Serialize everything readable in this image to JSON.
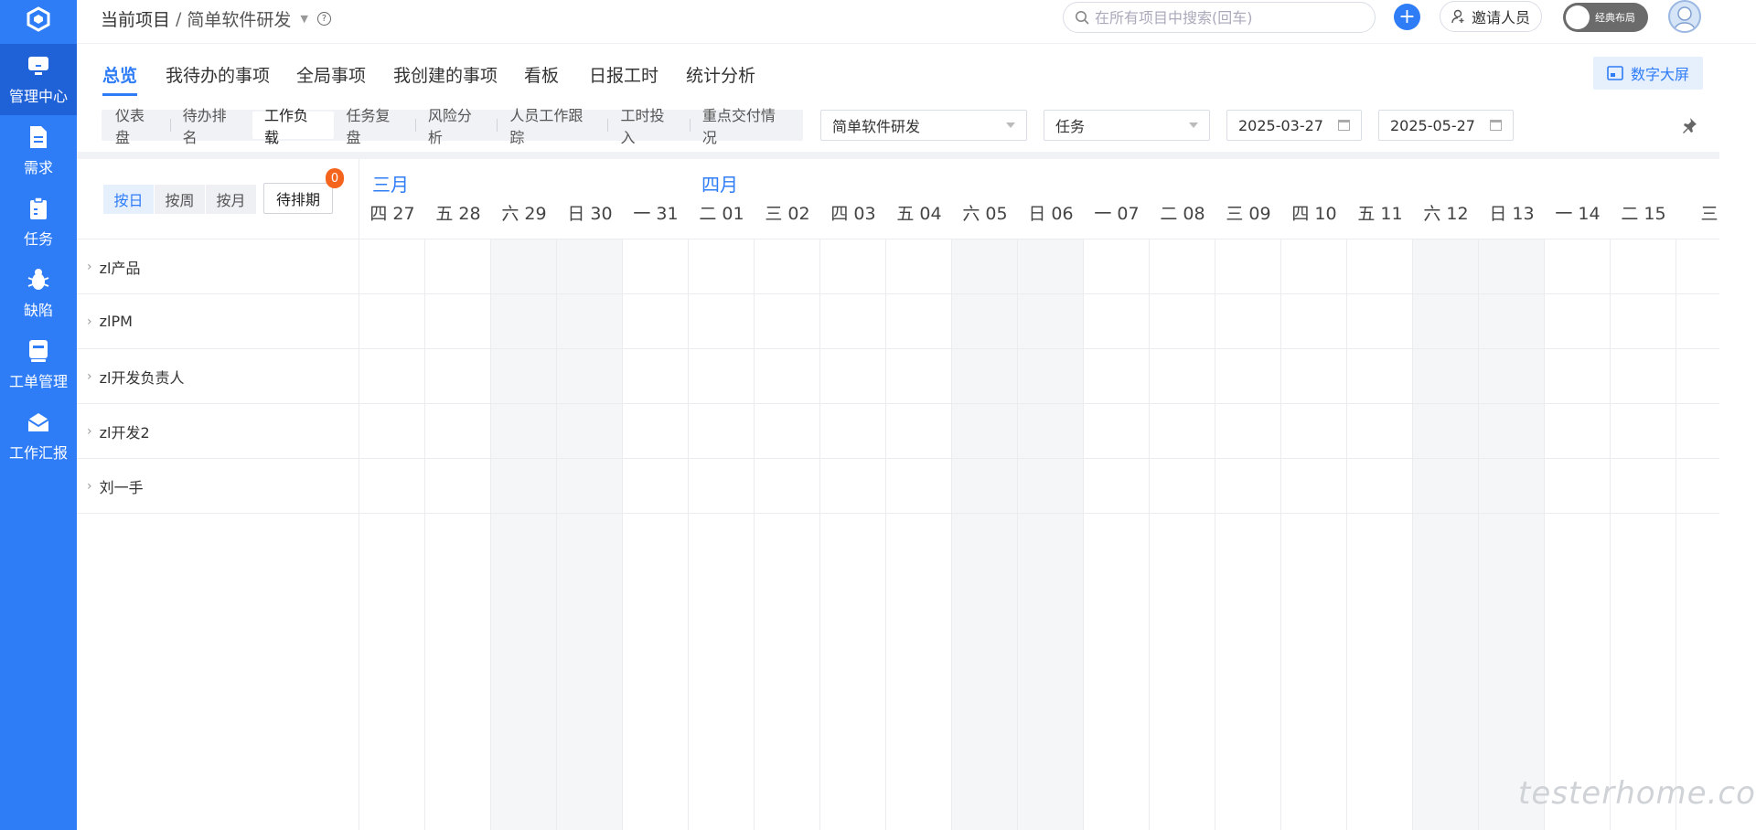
{
  "sidebar": {
    "items": [
      {
        "label": "管理中心",
        "icon": "monitor-icon"
      },
      {
        "label": "需求",
        "icon": "document-icon"
      },
      {
        "label": "任务",
        "icon": "clipboard-icon"
      },
      {
        "label": "缺陷",
        "icon": "bug-icon"
      },
      {
        "label": "工单管理",
        "icon": "ticket-icon"
      },
      {
        "label": "工作汇报",
        "icon": "envelope-icon"
      }
    ]
  },
  "header": {
    "breadcrumb_root": "当前项目",
    "breadcrumb_sep": "/",
    "project": "简单软件研发",
    "help": "?",
    "search_placeholder": "在所有项目中搜索(回车)",
    "add": "+",
    "invite": "邀请人员",
    "toggle_label": "经典布局"
  },
  "tabs": [
    "总览",
    "我待办的事项",
    "全局事项",
    "我创建的事项",
    "看板",
    "日报工时",
    "统计分析"
  ],
  "big_screen": "数字大屏",
  "subtabs": [
    "仪表盘",
    "待办排名",
    "工作负载",
    "任务复盘",
    "风险分析",
    "人员工作跟踪",
    "工时投入",
    "重点交付情况"
  ],
  "filters": {
    "project": "简单软件研发",
    "type": "任务",
    "start_date": "2025-03-27",
    "end_date": "2025-05-27"
  },
  "granularity": [
    "按日",
    "按周",
    "按月"
  ],
  "pending_label": "待排期",
  "pending_count": "0",
  "months": [
    "三月",
    "四月"
  ],
  "days": [
    "四 27",
    "五 28",
    "六 29",
    "日 30",
    "一 31",
    "二 01",
    "三 02",
    "四 03",
    "五 04",
    "六 05",
    "日 06",
    "一 07",
    "二 08",
    "三 09",
    "四 10",
    "五 11",
    "六 12",
    "日 13",
    "一 14",
    "二 15",
    "三"
  ],
  "members": [
    "zl产品",
    "zlPM",
    "zl开发负责人",
    "zl开发2",
    "刘一手"
  ],
  "watermark": "testerhome.com"
}
